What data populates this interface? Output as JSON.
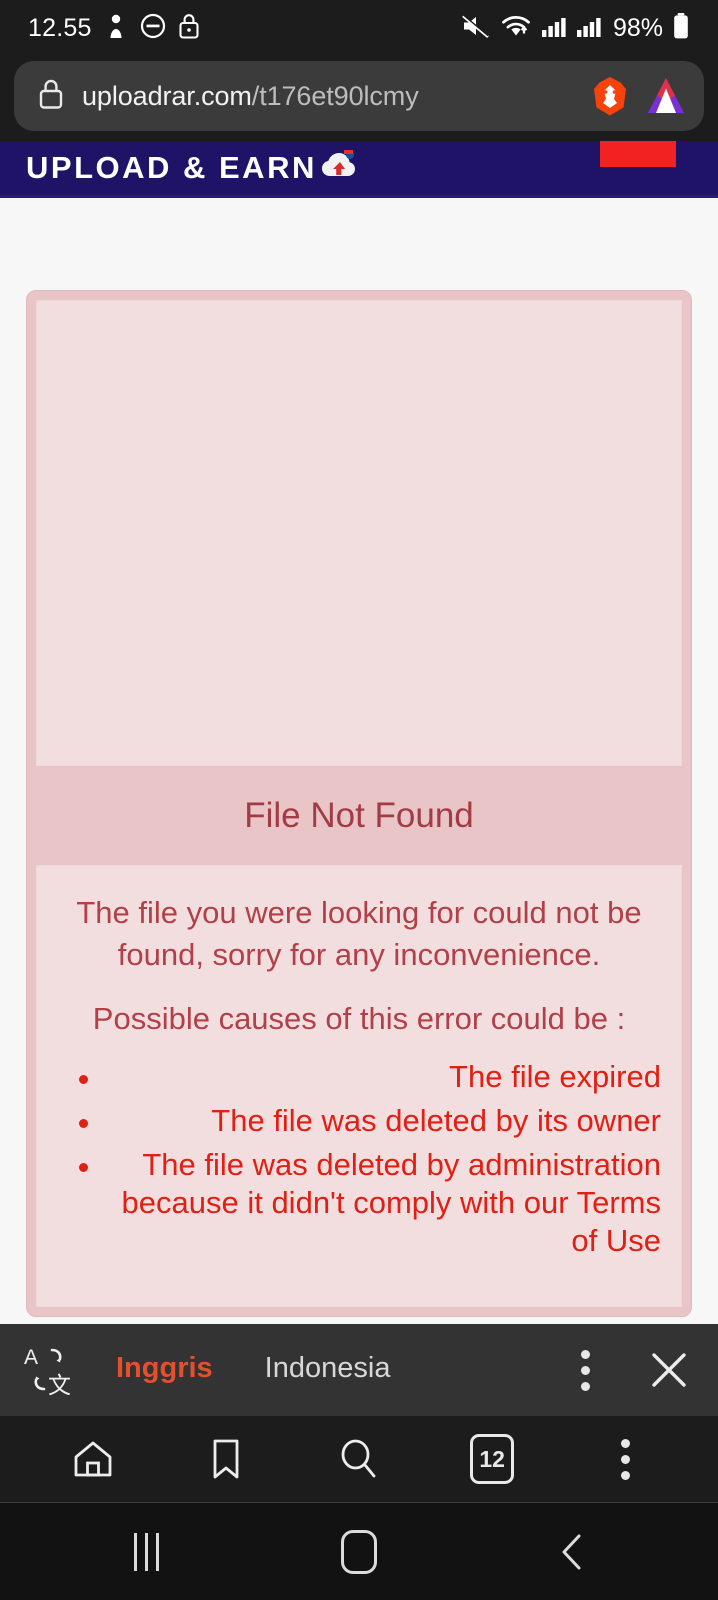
{
  "status_bar": {
    "time": "12.55",
    "battery_percent": "98%",
    "icons": [
      "do-not-disturb-icon",
      "screen-lock-icon",
      "mute-icon",
      "wifi-icon",
      "signal-bars-icon",
      "signal-bars-2-icon",
      "battery-icon"
    ]
  },
  "url_bar": {
    "lock_icon": "lock-icon",
    "domain": "uploadrar.com",
    "path": "/t176et90lcmy",
    "full_url": "uploadrar.com/t176et90lcmy",
    "brave_icon": "brave-lion-icon",
    "bat_icon": "bat-triangle-icon"
  },
  "site": {
    "brand": "UPLOAD & EARN",
    "brand_logo_icon": "upload-cloud-logo-icon",
    "header_bg": "#1e1366",
    "header_button_color": "#f32222",
    "header_button_label": ""
  },
  "alert": {
    "title": "File Not Found",
    "paragraphs": [
      "The file you were looking for could not be found, sorry for any inconvenience.",
      "Possible causes of this error could be :"
    ],
    "causes": [
      "The file expired",
      "The file was deleted by its owner",
      "The file was deleted by administration because it didn't comply with our Terms of Use"
    ],
    "title_color": "#a33b44",
    "text_color": "#b14049",
    "list_color": "#e02015",
    "card_bg": "#e9c5c8",
    "panel_bg": "#f3dedf"
  },
  "translate_bar": {
    "icon": "translate-icon",
    "source_language": "Inggris",
    "target_language": "Indonesia",
    "active_language": "Inggris",
    "accent_color": "#e2502c",
    "menu_icon": "kebab-menu-icon",
    "close_icon": "close-icon"
  },
  "browser_toolbar": {
    "items": [
      {
        "name": "home-icon",
        "label": ""
      },
      {
        "name": "bookmark-icon",
        "label": ""
      },
      {
        "name": "search-icon",
        "label": ""
      },
      {
        "name": "tab-switcher-icon",
        "label": "12"
      },
      {
        "name": "kebab-menu-icon",
        "label": ""
      }
    ],
    "tab_count": "12"
  },
  "android_nav": {
    "recents_icon": "recents-icon",
    "home_icon": "home-square-icon",
    "back_icon": "back-chevron-icon"
  }
}
